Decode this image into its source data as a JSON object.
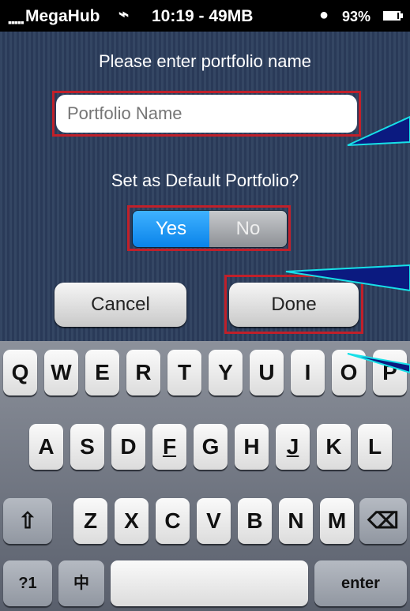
{
  "status_bar": {
    "signal": "▪▪▪▪▪",
    "carrier": "MegaHub",
    "wifi_icon": "wifi-icon",
    "time_memory": "10:19 - 49MB",
    "chat_icon": "chat-bubble-icon",
    "battery": "93%",
    "battery_icon": "battery-icon"
  },
  "dialog": {
    "prompt": "Please enter portfolio name",
    "name_field": {
      "value": "",
      "placeholder": "Portfolio Name"
    },
    "default_prompt": "Set as Default Portfolio?",
    "default_toggle": {
      "options": [
        "Yes",
        "No"
      ],
      "selected": "Yes"
    },
    "cancel_label": "Cancel",
    "done_label": "Done"
  },
  "colors": {
    "dialog_background": "#2c3e5d",
    "highlight_border": "#c0202a",
    "callout_line": "#17e0e8",
    "callout_fill": "#0b1a80",
    "toggle_selected": "#0a84ea"
  },
  "keyboard": {
    "row1": [
      "Q",
      "W",
      "E",
      "R",
      "T",
      "Y",
      "U",
      "I",
      "O",
      "P"
    ],
    "row2": [
      "A",
      "S",
      "D",
      "F",
      "G",
      "H",
      "J",
      "K",
      "L"
    ],
    "row3": [
      "Z",
      "X",
      "C",
      "V",
      "B",
      "N",
      "M"
    ],
    "shift_icon": "shift-icon",
    "backspace_icon": "backspace-icon",
    "numbers_key": "?1",
    "language_key": "中",
    "space_key": "",
    "enter_key": "enter"
  }
}
